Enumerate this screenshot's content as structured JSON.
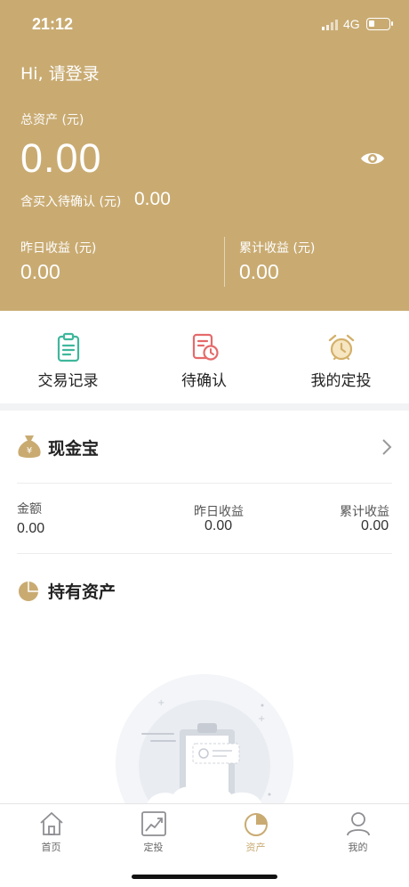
{
  "status_bar": {
    "time": "21:12",
    "network": "4G",
    "battery_level": 0.3
  },
  "header": {
    "greeting": "Hi, 请登录",
    "total_assets_label": "总资产 (元)",
    "total_assets_value": "0.00",
    "pending_label": "含买入待确认 (元)",
    "pending_value": "0.00",
    "yesterday_label": "昨日收益 (元)",
    "yesterday_value": "0.00",
    "cumulative_label": "累计收益 (元)",
    "cumulative_value": "0.00"
  },
  "quick_actions": [
    {
      "label": "交易记录",
      "icon": "clipboard-icon"
    },
    {
      "label": "待确认",
      "icon": "pending-clock-icon"
    },
    {
      "label": "我的定投",
      "icon": "alarm-clock-icon"
    }
  ],
  "cash_treasure": {
    "title": "现金宝",
    "amount_label": "金额",
    "amount_value": "0.00",
    "yesterday_label": "昨日收益",
    "yesterday_value": "0.00",
    "cumulative_label": "累计收益",
    "cumulative_value": "0.00"
  },
  "holdings": {
    "title": "持有资产"
  },
  "tabbar": {
    "items": [
      {
        "label": "首页",
        "icon": "home-icon"
      },
      {
        "label": "定投",
        "icon": "chart-trend-icon"
      },
      {
        "label": "资产",
        "icon": "pie-chart-icon"
      },
      {
        "label": "我的",
        "icon": "user-icon"
      }
    ],
    "active": "资产"
  },
  "colors": {
    "accent": "#c9ab72",
    "teal": "#3fb79c",
    "red": "#e56a6a",
    "gold": "#d4b06a"
  }
}
